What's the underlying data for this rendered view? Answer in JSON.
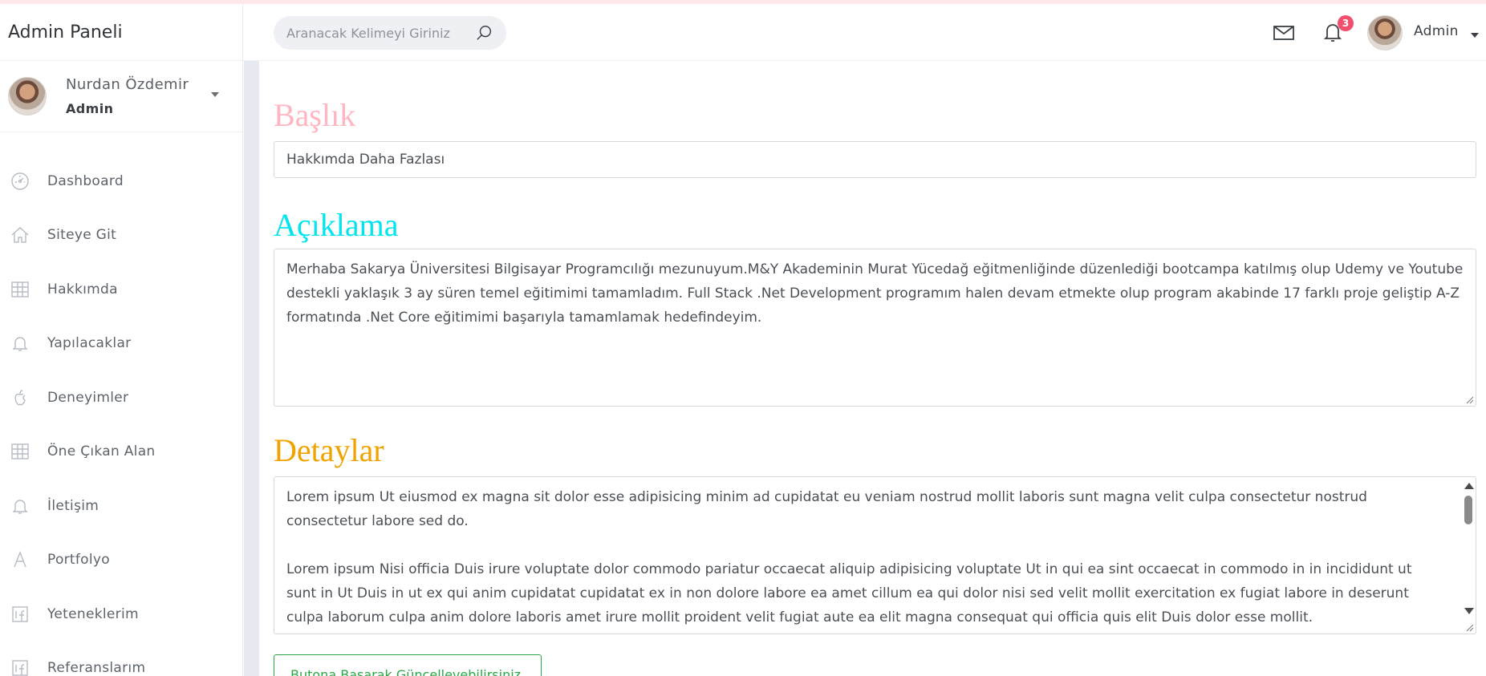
{
  "sidebar": {
    "brand": "Admin Paneli",
    "user": {
      "name": "Nurdan Özdemir",
      "role": "Admin"
    },
    "items": [
      {
        "label": "Dashboard",
        "icon": "gauge-icon"
      },
      {
        "label": "Siteye Git",
        "icon": "home-icon"
      },
      {
        "label": "Hakkımda",
        "icon": "grid-icon"
      },
      {
        "label": "Yapılacaklar",
        "icon": "bell-icon"
      },
      {
        "label": "Deneyimler",
        "icon": "apple-icon"
      },
      {
        "label": "Öne Çıkan Alan",
        "icon": "grid-icon"
      },
      {
        "label": "İletişim",
        "icon": "bell-icon"
      },
      {
        "label": "Portfolyo",
        "icon": "font-icon"
      },
      {
        "label": "Yeteneklerim",
        "icon": "facebook-square-icon"
      },
      {
        "label": "Referanslarım",
        "icon": "facebook-square-icon"
      }
    ]
  },
  "header": {
    "search_placeholder": "Aranacak Kelimeyi Giriniz",
    "notification_count": "3",
    "user_label": "Admin"
  },
  "form": {
    "title_label": "Başlık",
    "title_value": "Hakkımda Daha Fazlası",
    "description_label": "Açıklama",
    "description_value": "Merhaba Sakarya Üniversitesi Bilgisayar Programcılığı mezunuyum.M&Y Akademinin Murat Yücedağ eğitmenliğinde düzenlediği bootcampa katılmış olup Udemy ve Youtube destekli yaklaşık 3 ay süren temel eğitimimi tamamladım. Full Stack .Net Development programım halen devam etmekte olup program akabinde 17 farklı proje geliştip A-Z formatında .Net Core eğitimimi başarıyla tamamlamak hedefindeyim.",
    "details_label": "Detaylar",
    "details_paragraphs": [
      "Lorem ipsum Ut eiusmod ex magna sit dolor esse adipisicing minim ad cupidatat eu veniam nostrud mollit laboris sunt magna velit culpa consectetur nostrud consectetur labore sed do.",
      "Lorem ipsum Nisi officia Duis irure voluptate dolor commodo pariatur occaecat aliquip adipisicing voluptate Ut in qui ea sint occaecat in commodo in in incididunt ut sunt in Ut Duis in ut ex qui anim cupidatat cupidatat ex in non dolore labore ea amet cillum ea qui dolor nisi sed velit mollit exercitation ex fugiat labore in deserunt culpa laborum culpa anim dolore laboris amet irure mollit proident velit fugiat aute ea elit magna consequat qui officia quis elit Duis dolor esse mollit."
    ],
    "submit_label": "Butona Basarak Güncellevebilirsiniz"
  },
  "colors": {
    "title_label": "#ffb6c1",
    "description_label": "#00e5ee",
    "details_label": "#f0a300",
    "badge": "#f0506e",
    "submit": "#28a745"
  }
}
